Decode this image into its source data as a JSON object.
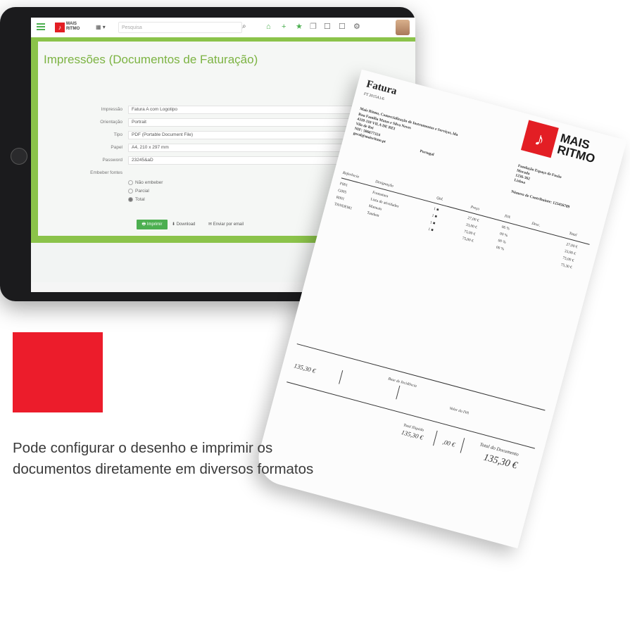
{
  "app": {
    "search_placeholder": "Pesquisa",
    "page_title": "Impressões (Documentos de Faturação)",
    "logo_text": "MAIS RITMO",
    "grid_label": "▦ ▾"
  },
  "form": {
    "fields": [
      {
        "label": "Impressão",
        "value": "Fatura A com Logotipo"
      },
      {
        "label": "Orientação",
        "value": "Portrait"
      },
      {
        "label": "Tipo",
        "value": "PDF (Portable Document File)"
      },
      {
        "label": "Papel",
        "value": "A4, 210 x 297 mm"
      },
      {
        "label": "Password",
        "value": "23245&aD"
      }
    ],
    "embed_label": "Embeber fontes",
    "embed_options": [
      {
        "label": "Não embeber",
        "selected": false
      },
      {
        "label": "Parcial",
        "selected": false
      },
      {
        "label": "Total",
        "selected": true
      }
    ],
    "buttons": {
      "print": "Imprimir",
      "download": "Download",
      "email": "Enviar por email"
    }
  },
  "invoice": {
    "title": "Fatura",
    "doc_no": "FT 2015A1/6",
    "company": "Mais Ritmo, Comercialização de Instrumentos e Serviços, lda",
    "address1": "Rua Familia Matos e Silva Neves",
    "address2": "4310-110 VILA DE REI",
    "address3": "Vila de Rei",
    "nif": "NIF: 506677324",
    "email": "geral@maisritmo.pt",
    "country": "Portugal",
    "brand": "MAIS RITMO",
    "client_name": "Fundação Espaço de Fusão",
    "client_sub": "Morada",
    "client_code": "1236-362",
    "client_city": "Lisboa",
    "taxpayer": "Número de Contribuinte: 123456789",
    "cols": [
      "Referência",
      "Designação",
      "Qtd.",
      "Preço",
      "IVA",
      "Desc.",
      "Total"
    ],
    "rows": [
      {
        "ref": "F001",
        "desc": "Formatura",
        "qty": "1 ■",
        "price": "27,00 €",
        "iva": "06 %",
        "total": "27,00 €"
      },
      {
        "ref": "G005",
        "desc": "Lista de atividades",
        "qty": "1 ■",
        "price": "33,00 €",
        "iva": "00 %",
        "total": "33,00 €"
      },
      {
        "ref": "R001",
        "desc": "Manuais",
        "qty": "1 ■",
        "price": "75,00 €",
        "iva": "00 %",
        "total": "75,00 €"
      },
      {
        "ref": "TANDEM1",
        "desc": "Tandem",
        "qty": "1 ■",
        "price": "75,00 €",
        "iva": "00 %",
        "total": "75,30 €"
      }
    ],
    "taxable": "Base de Incidência",
    "taxable_val": "135,30 €",
    "iva_total": "Valor do IVA",
    "total_label": "Total do Documento",
    "total_val": "135,30 €",
    "sub_total": "Total Ilíquido",
    "sub_total_val": "135,30 €",
    "iva_val": ",00 €"
  },
  "caption": "Pode configurar o desenho e imprimir os documentos diretamente em diversos formatos",
  "colors": {
    "accent_green": "#4caf50",
    "brand_red": "#ec1c2b"
  }
}
